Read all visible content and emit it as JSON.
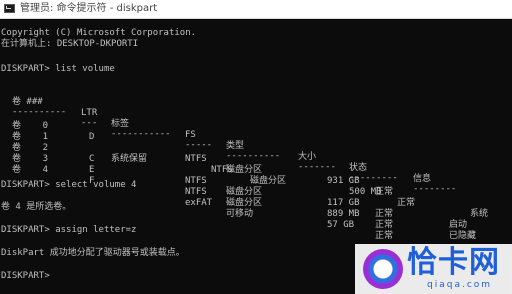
{
  "window": {
    "title": "管理员: 命令提示符 - diskpart"
  },
  "console": {
    "header": [
      "Copyright (C) Microsoft Corporation.",
      "在计算机上: DESKTOP-DKPORTI"
    ],
    "prompt": "DISKPART> ",
    "cmd_list": "list volume",
    "columns": [
      "卷 ###",
      "LTR",
      "标签",
      "FS",
      "类型",
      "大小",
      "状态",
      "信息"
    ],
    "separators": [
      "----------",
      "---",
      "-----------",
      "-----",
      "----------",
      "-------",
      "---------",
      "--------"
    ],
    "rows": [
      {
        "vol": "卷    0",
        "ltr": "D",
        "label": "",
        "fs": "NTFS",
        "type": "磁盘分区",
        "size": "931 GB",
        "status": "正常",
        "info": ""
      },
      {
        "vol": "卷    1",
        "ltr": "",
        "label": "系统保留",
        "fs": "NTFS",
        "type": "磁盘分区",
        "size": "500 MB",
        "status": "正常",
        "info": "系统"
      },
      {
        "vol": "卷    2",
        "ltr": "C",
        "label": "",
        "fs": "NTFS",
        "type": "磁盘分区",
        "size": "117 GB",
        "status": "正常",
        "info": "启动"
      },
      {
        "vol": "卷    3",
        "ltr": "E",
        "label": "",
        "fs": "NTFS",
        "type": "磁盘分区",
        "size": "889 MB",
        "status": "正常",
        "info": "已隐藏"
      },
      {
        "vol": "卷    4",
        "ltr": "F",
        "label": "",
        "fs": "exFAT",
        "type": "可移动",
        "size": "57 GB",
        "status": "正常",
        "info": ""
      }
    ],
    "cmd_select": "select volume 4",
    "out_select": "卷 4 是所选卷。",
    "cmd_assign": "assign letter=z",
    "out_assign": "DiskPart 成功地分配了驱动器号或装载点。",
    "final_prompt": "DISKPART>"
  },
  "watermark": {
    "brand": "恰卡网",
    "domain": "qiaqa.com"
  }
}
